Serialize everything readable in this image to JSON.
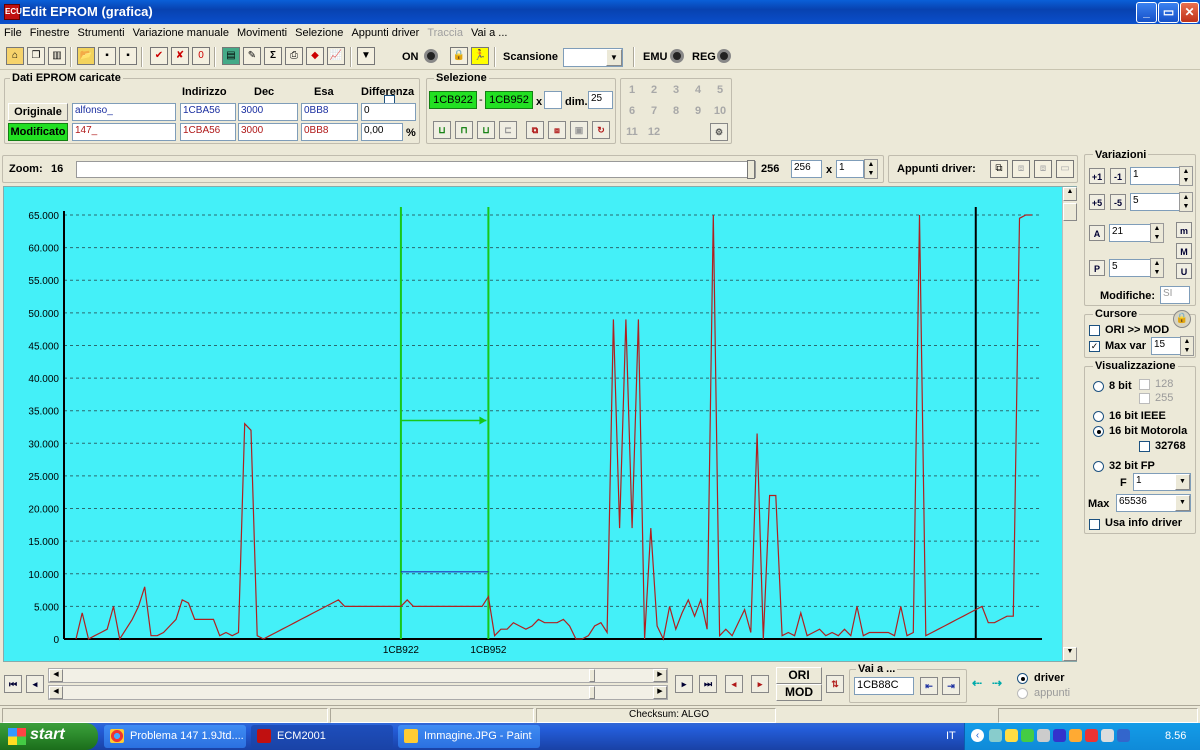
{
  "window": {
    "title": "Edit EPROM (grafica)",
    "icon_text": "ECU",
    "minimize_icon": "minimize-icon",
    "maximize_icon": "maximize-icon",
    "close_icon": "close-icon"
  },
  "menu": [
    "File",
    "Finestre",
    "Strumenti",
    "Variazione manuale",
    "Movimenti",
    "Selezione",
    "Appunti driver",
    "Traccia",
    "Vai a ..."
  ],
  "menu_disabled_index": 7,
  "toolbar": {
    "on_label": "ON",
    "scan_label": "Scansione",
    "scan_value": "",
    "emu_label": "EMU",
    "reg_label": "REG"
  },
  "eprom": {
    "group_title": "Dati EPROM caricate",
    "headers": {
      "indirizzo": "Indirizzo",
      "dec": "Dec",
      "esa": "Esa",
      "differenza": "Differenza"
    },
    "original": {
      "label": "Originale",
      "name": "alfonso_",
      "address": "1CBA56",
      "dec": "3000",
      "hex": "0BB8",
      "diff": "0"
    },
    "modified": {
      "label": "Modificato",
      "name": "147_",
      "address": "1CBA56",
      "dec": "3000",
      "hex": "0BB8",
      "diff": "0,00",
      "diff_unit": "%"
    }
  },
  "selection": {
    "group_title": "Selezione",
    "start": "1CB922",
    "dash": "-",
    "end": "1CB952",
    "x_label": "x",
    "x_value": "",
    "dim_label": "dim.",
    "dim_value": "25"
  },
  "numpad": [
    "1",
    "2",
    "3",
    "4",
    "5",
    "6",
    "7",
    "8",
    "9",
    "10",
    "11",
    "12"
  ],
  "zoom": {
    "label": "Zoom:",
    "value": "16",
    "max": "256",
    "field": "256",
    "x_label": "x",
    "factor": "1"
  },
  "appunti": {
    "label": "Appunti driver:"
  },
  "variazioni": {
    "title": "Variazioni",
    "step1": "1",
    "step2": "5",
    "val3": "21",
    "val4": "5",
    "modifiche_label": "Modifiche:",
    "modifiche_value": "SI"
  },
  "cursore": {
    "title": "Cursore",
    "ori_mod_label": "ORI >> MOD",
    "ori_mod_checked": false,
    "maxvar_label": "Max var",
    "maxvar_checked": true,
    "maxvar_value": "15"
  },
  "visualizzazione": {
    "title": "Visualizzazione",
    "bit8": "8 bit",
    "opt128": "128",
    "opt255": "255",
    "ieee": "16 bit IEEE",
    "motorola": "16 bit Motorola",
    "opt32768": "32768",
    "fp32": "32 bit FP",
    "f_label": "F",
    "f_value": "1",
    "max_label": "Max",
    "max_value": "65536",
    "usa_info": "Usa info driver",
    "selected": "16 bit Motorola"
  },
  "bottom": {
    "ori_label": "ORI",
    "mod_label": "MOD",
    "vai_title": "Vai a ...",
    "vai_value": "1CB88C",
    "driver_label": "driver",
    "appunti_label": "appunti"
  },
  "status": {
    "checksum": "Checksum: ALGO"
  },
  "taskbar": {
    "start": "start",
    "tasks": [
      "Problema 147 1.9Jtd....",
      "ECM2001",
      "Immagine.JPG - Paint"
    ],
    "lang": "IT",
    "clock": "8.56"
  },
  "chart_data": {
    "type": "line",
    "ylim": [
      0,
      65000
    ],
    "yticks": [
      "0",
      "5.000",
      "10.000",
      "15.000",
      "20.000",
      "25.000",
      "30.000",
      "35.000",
      "40.000",
      "45.000",
      "50.000",
      "55.000",
      "60.000",
      "65.000"
    ],
    "x_markers": [
      {
        "label": "1CB922",
        "index": 52
      },
      {
        "label": "1CB952",
        "index": 66
      }
    ],
    "cursor_index": 144,
    "grid": true,
    "series": [
      {
        "color": "#b02020",
        "values": [
          0,
          4000,
          0,
          500,
          1000,
          1500,
          5000,
          0,
          1500,
          3000,
          5000,
          8000,
          500,
          500,
          1000,
          2000,
          3000,
          6000,
          5500,
          3000,
          3000,
          3000,
          3000,
          500,
          1000,
          500,
          1000,
          33000,
          32000,
          500,
          0,
          500,
          1000,
          1500,
          2000,
          2500,
          3000,
          3500,
          4000,
          4500,
          5000,
          5500,
          6000,
          5000,
          5000,
          5000,
          5000,
          5000,
          5000,
          5000,
          5000,
          5000,
          5000,
          6000,
          5000,
          5000,
          5000,
          5000,
          5000,
          5000,
          5000,
          5000,
          5000,
          5000,
          5000,
          5000,
          6500,
          500,
          1500,
          1500,
          2500,
          2000,
          1500,
          2000,
          3000,
          2500,
          2500,
          2500,
          3000,
          2000,
          0,
          0,
          500,
          2000,
          2500,
          1000,
          49000,
          17000,
          49000,
          17000,
          49000,
          0,
          17000,
          2000,
          0,
          5000,
          1500,
          4000,
          6000,
          3500,
          6000,
          1500,
          65000,
          500,
          1500,
          500,
          2500,
          4500,
          1000,
          31500,
          0,
          22000,
          22000,
          500,
          1000,
          500,
          4000,
          500,
          1000,
          1500,
          500,
          1000,
          500,
          1500,
          500,
          5000,
          500,
          1000,
          1000,
          1000,
          1000,
          500,
          5000,
          500,
          1000,
          65000,
          500,
          1000,
          1500,
          2000,
          2500,
          3000,
          3500,
          4000,
          4500,
          5000,
          2500,
          2500,
          3000,
          3500,
          3500,
          64500,
          65000,
          65000
        ]
      }
    ]
  }
}
